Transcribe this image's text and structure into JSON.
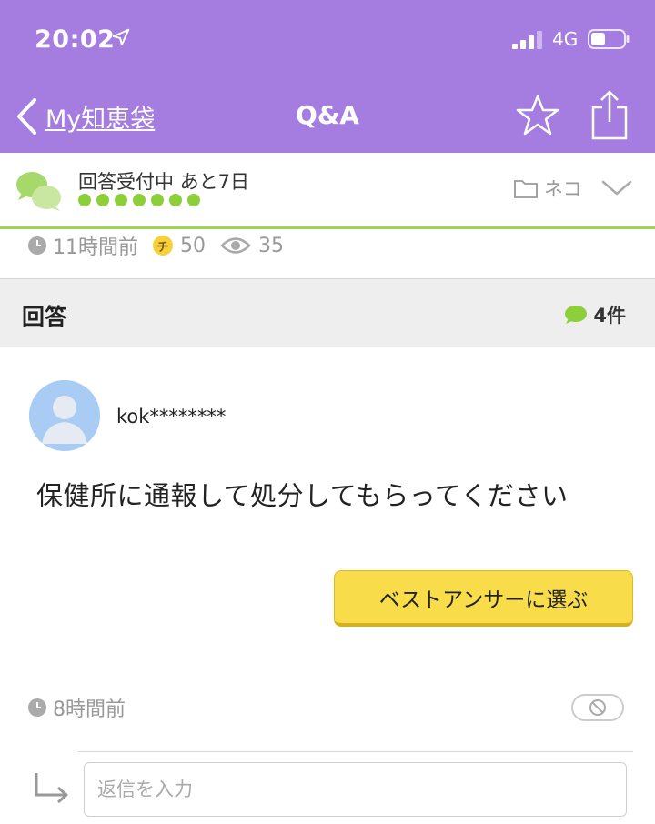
{
  "status_bar": {
    "time": "20:02",
    "network": "4G"
  },
  "nav": {
    "back_label": "My知恵袋",
    "title": "Q&A"
  },
  "question_status": {
    "status_text": "回答受付中 あと7日",
    "progress_dots": 7,
    "category": "ネコ"
  },
  "stats": {
    "posted_ago": "11時間前",
    "coins": "50",
    "views": "35",
    "coin_symbol": "チ"
  },
  "answers_header": {
    "title": "回答",
    "count": "4件"
  },
  "answer": {
    "username": "kok********",
    "text": "保健所に通報して処分してもらってください",
    "best_answer_button": "ベストアンサーに選ぶ",
    "posted_ago": "8時間前"
  },
  "reply": {
    "placeholder": "返信を入力"
  },
  "colors": {
    "header_purple": "#a57de0",
    "accent_green": "#8ccf3a",
    "button_yellow": "#f8dc4a"
  }
}
